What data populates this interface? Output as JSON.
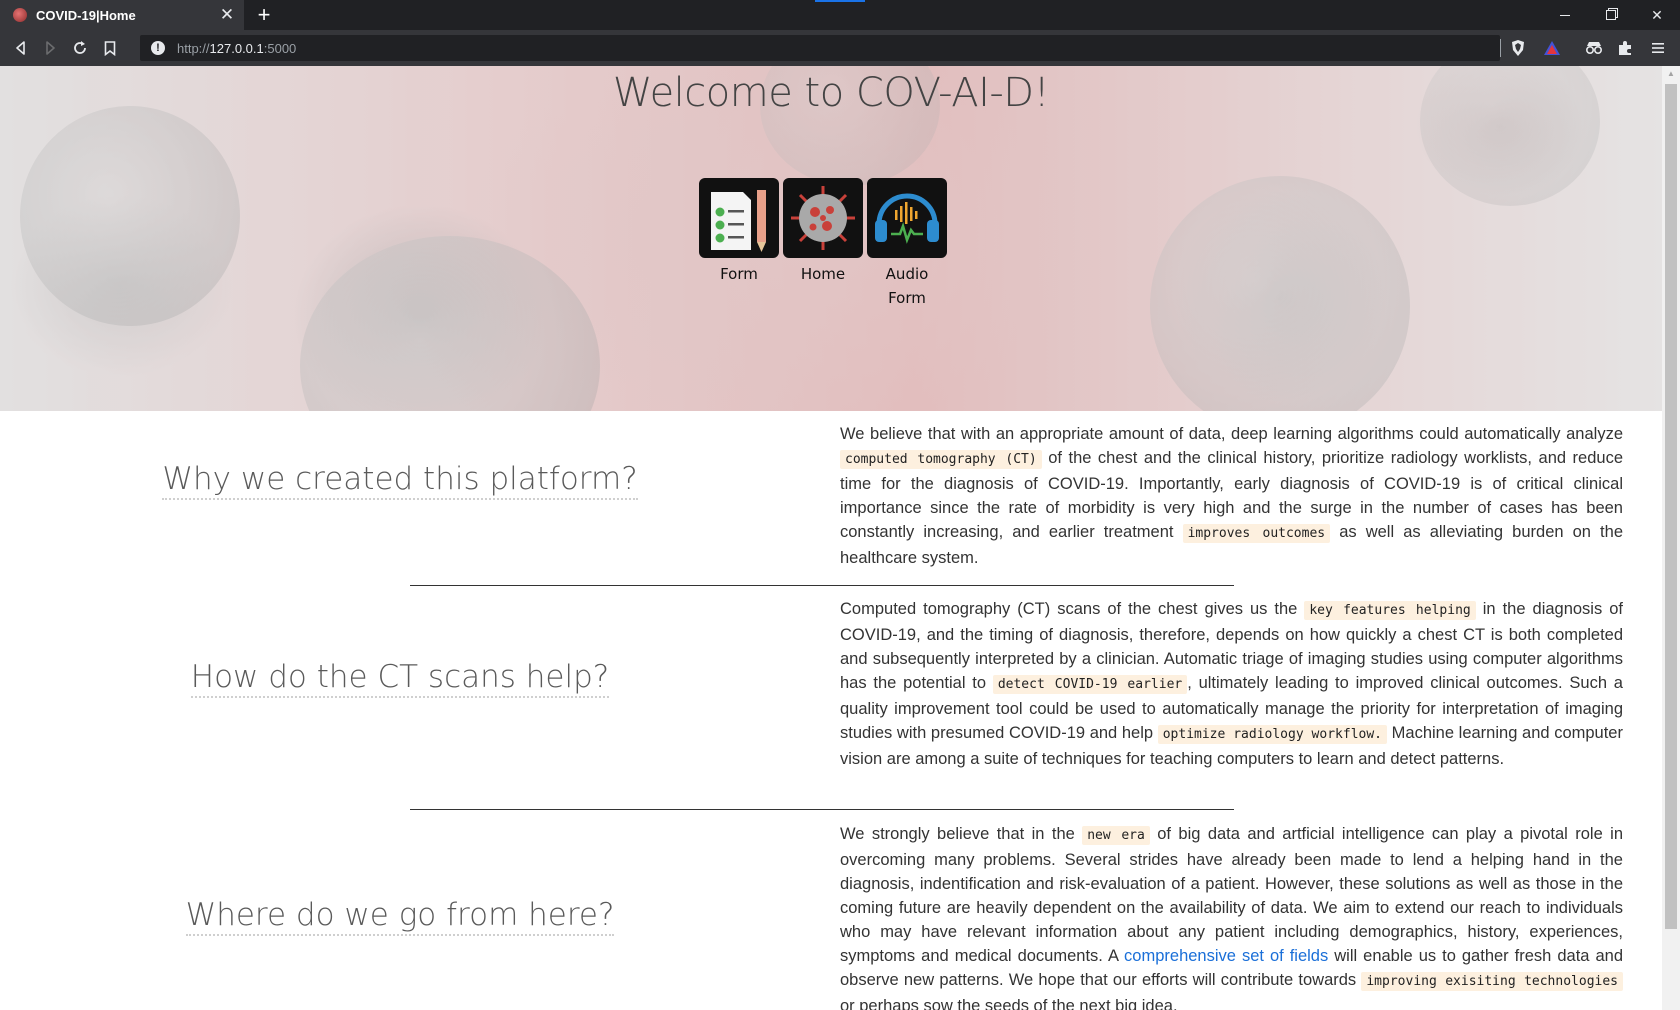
{
  "browser": {
    "tab_title": "COVID-19|Home",
    "tab_close": "✕",
    "new_tab": "+",
    "url_prefix": "http://",
    "url_host": "127.0.0.1",
    "url_suffix": ":5000"
  },
  "hero": {
    "title": "Welcome to COV-AI-D!",
    "nav": [
      {
        "label": "Form",
        "icon": "form-checklist-icon"
      },
      {
        "label": "Home",
        "icon": "coronavirus-icon"
      },
      {
        "label": "Audio Form",
        "icon": "headphones-audio-icon"
      }
    ]
  },
  "sections": [
    {
      "heading": "Why we created this platform?",
      "p": [
        "We believe that with an appropriate amount of data, deep learning algorithms could automatically analyze ",
        "computed tomography (CT)",
        " of the chest and the clinical history, prioritize radiology worklists, and reduce time for the diagnosis of COVID-19. Importantly, early diagnosis of COVID-19 is of critical clinical importance since the rate of morbidity is very high and the surge in the number of cases has been constantly increasing, and earlier treatment ",
        "improves outcomes",
        " as well as alleviating burden on the healthcare system."
      ]
    },
    {
      "heading": "How do the CT scans help?",
      "p": [
        "Computed tomography (CT) scans of the chest gives us the ",
        "key features helping",
        " in the diagnosis of COVID-19, and the timing of diagnosis, therefore, depends on how quickly a chest CT is both completed and subsequently interpreted by a clinician. Automatic triage of imaging studies using computer algorithms has the potential to ",
        "detect COVID-19 earlier",
        ", ultimately leading to improved clinical outcomes. Such a quality improvement tool could be used to automatically manage the priority for interpretation of imaging studies with presumed COVID-19 and help ",
        "optimize radiology workflow.",
        " Machine learning and computer vision are among a suite of techniques for teaching computers to learn and detect patterns."
      ]
    },
    {
      "heading": "Where do we go from here?",
      "p": [
        "We strongly believe that in the ",
        "new era",
        " of big data and artficial intelligence can play a pivotal role in overcoming many problems. Several strides have already been made to lend a helping hand in the diagnosis, indentification and risk-evaluation of a patient. However, these solutions as well as those in the coming future are heavily dependent on the availability of data. We aim to extend our reach to individuals who may have relevant information about any patient including demographics, history, experiences, symptoms and medical documents. A ",
        "comprehensive set of fields",
        " will enable us to gather fresh data and observe new patterns. We hope that our efforts will contribute towards ",
        "improving exisiting technologies",
        " or perhaps sow the seeds of the next big idea."
      ]
    }
  ],
  "colors": {
    "link": "#1a6fd8",
    "code_bg": "#fdf0df",
    "chrome_dark": "#202124"
  }
}
